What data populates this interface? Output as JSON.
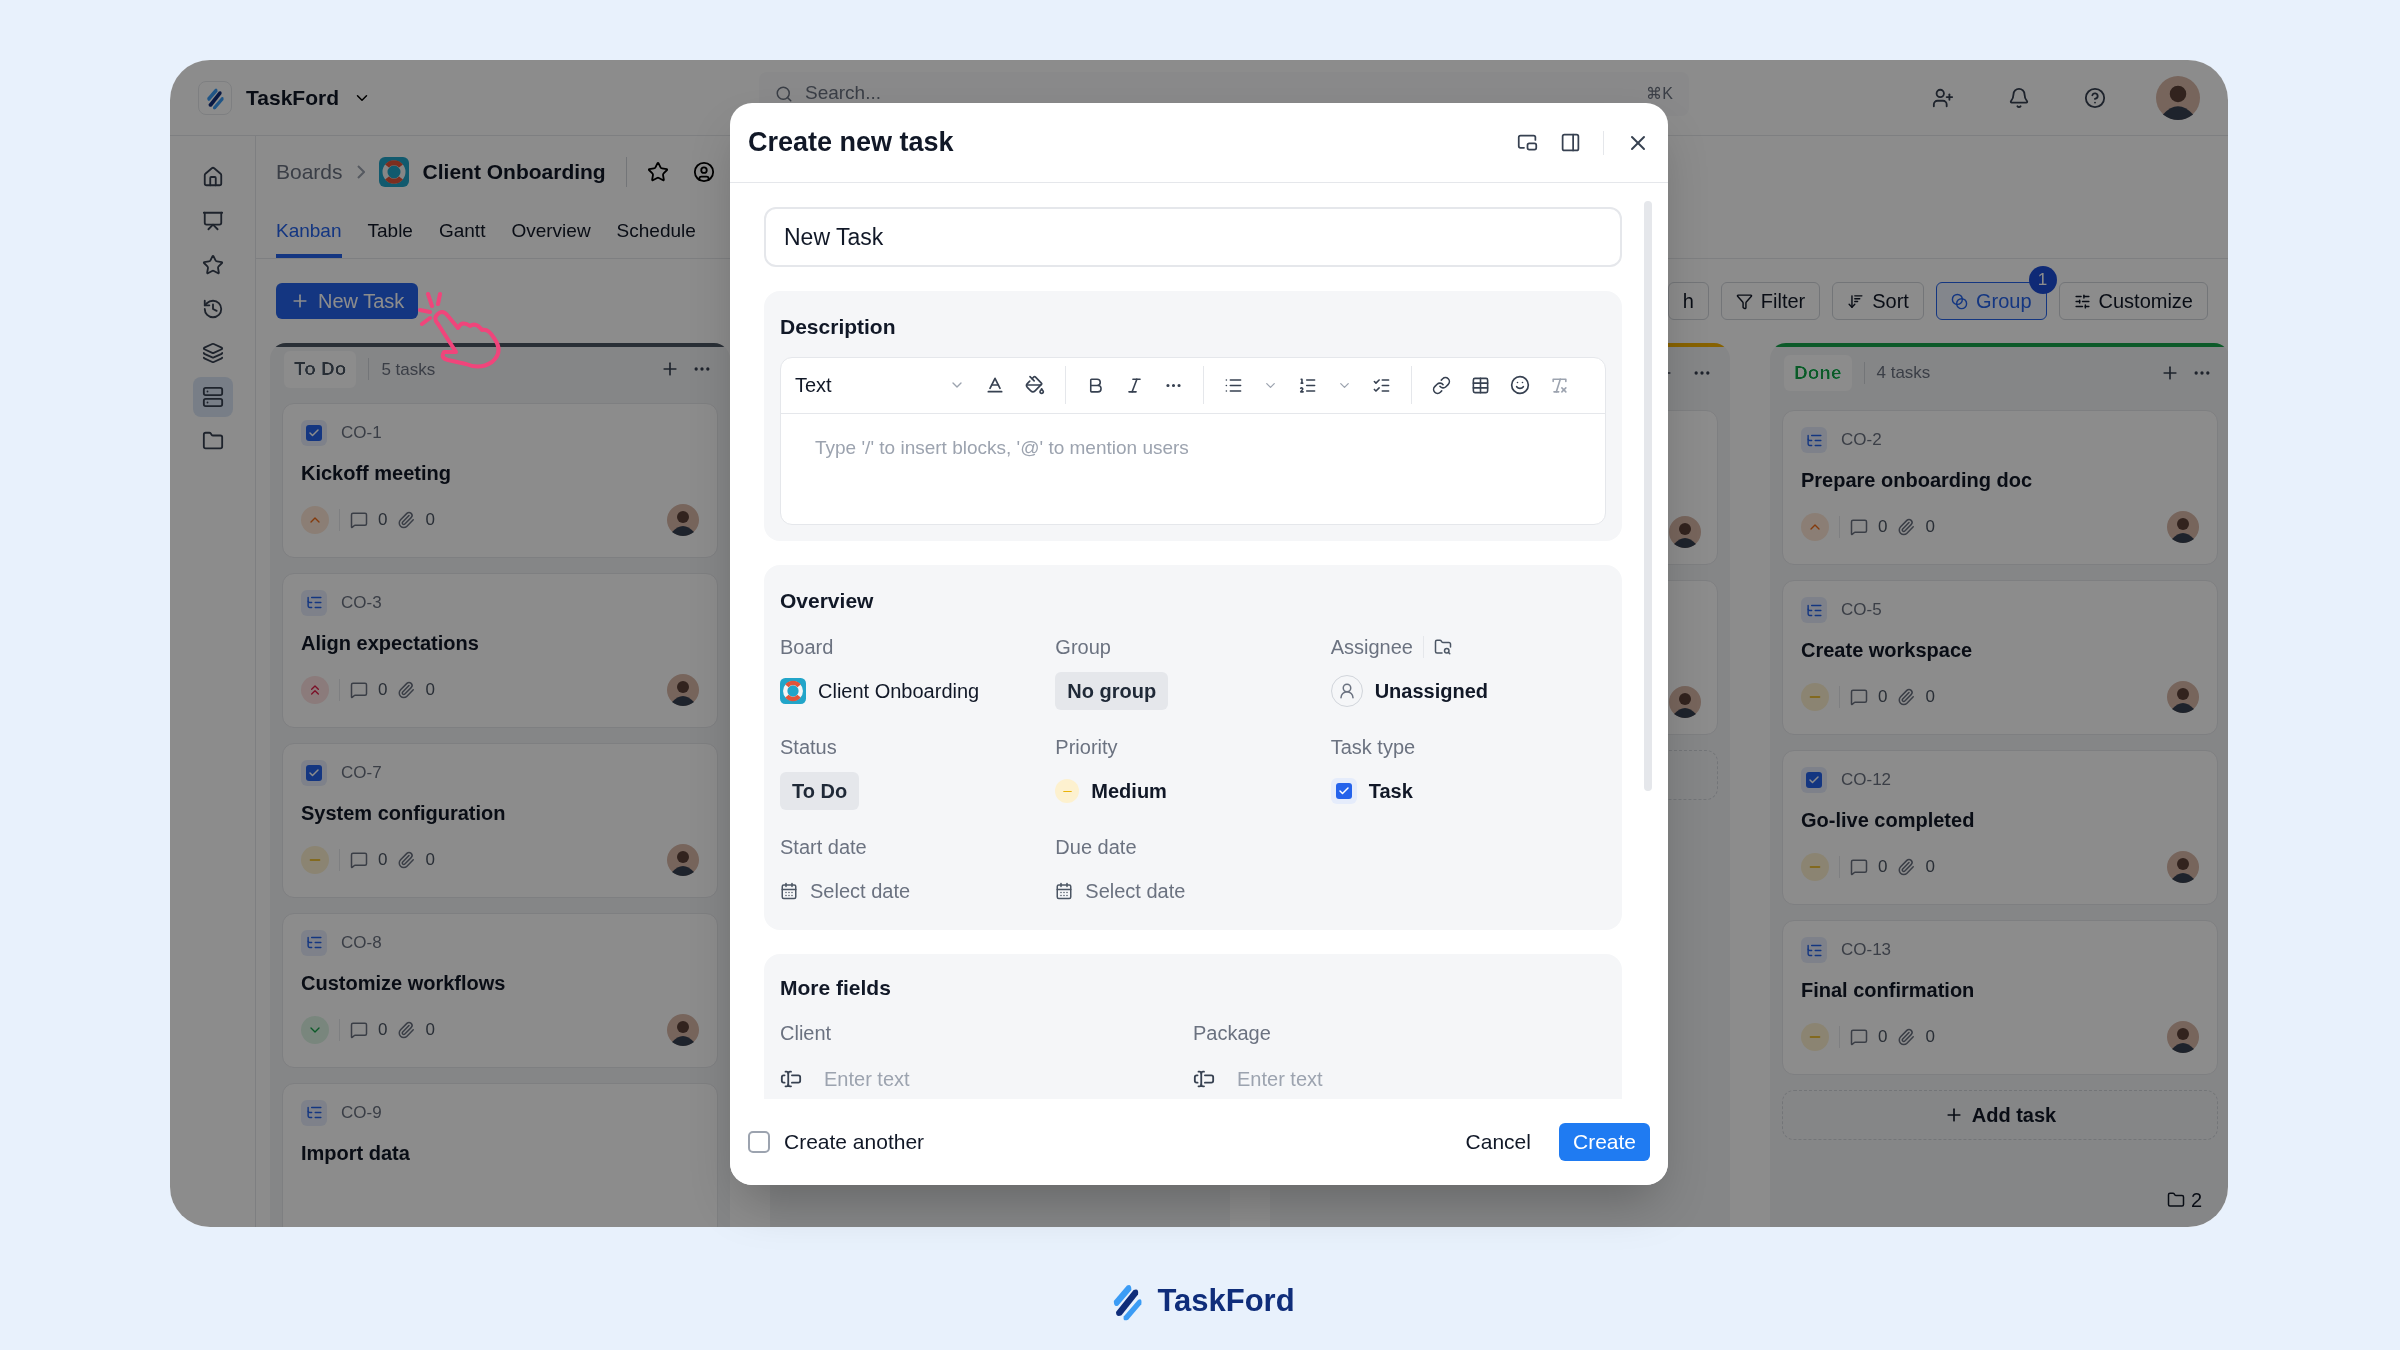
{
  "app": {
    "name": "TaskFord"
  },
  "search": {
    "placeholder": "Search...",
    "shortcut": "⌘K"
  },
  "breadcrumb": {
    "root": "Boards",
    "board": "Client Onboarding"
  },
  "tabs": [
    {
      "label": "Kanban",
      "selected": true
    },
    {
      "label": "Table",
      "selected": false
    },
    {
      "label": "Gantt",
      "selected": false
    },
    {
      "label": "Overview",
      "selected": false
    },
    {
      "label": "Schedule",
      "selected": false
    }
  ],
  "new_task_button": "New Task",
  "toolbar": [
    {
      "label": "h",
      "kind": "cut",
      "active": false
    },
    {
      "label": "Filter",
      "kind": "filter",
      "active": false
    },
    {
      "label": "Sort",
      "kind": "sort",
      "active": false
    },
    {
      "label": "Group",
      "kind": "group",
      "active": true,
      "badge": "1"
    },
    {
      "label": "Customize",
      "kind": "customize",
      "active": false
    }
  ],
  "columns": [
    {
      "kind": "open",
      "status": "To Do",
      "count": "5 tasks",
      "color": "#292f36",
      "cards": [
        {
          "id": "CO-1",
          "title": "Kickoff meeting",
          "kind": "task",
          "priority": {
            "kind": "high"
          },
          "comments": "0",
          "attachments": "0"
        },
        {
          "id": "CO-3",
          "title": "Align expectations",
          "kind": "subtask",
          "priority": {
            "kind": "urgent"
          },
          "comments": "0",
          "attachments": "0"
        },
        {
          "id": "CO-7",
          "title": "System configuration",
          "kind": "task",
          "priority": {
            "kind": "medium"
          },
          "comments": "0",
          "attachments": "0"
        },
        {
          "id": "CO-8",
          "title": "Customize workflows",
          "kind": "subtask",
          "priority": {
            "kind": "low"
          },
          "comments": "0",
          "attachments": "0"
        },
        {
          "id": "CO-9",
          "title": "Import data",
          "kind": "subtask"
        }
      ]
    },
    {
      "kind": "hidden"
    },
    {
      "kind": "covered",
      "color": "#876201"
    },
    {
      "kind": "open",
      "status": "Done",
      "count": "4 tasks",
      "color": "#0c5a29",
      "add_label": "Add task",
      "cards": [
        {
          "id": "CO-2",
          "title": "Prepare onboarding doc",
          "kind": "subtask",
          "priority": {
            "kind": "high"
          },
          "comments": "0",
          "attachments": "0"
        },
        {
          "id": "CO-5",
          "title": "Create workspace",
          "kind": "subtask",
          "priority": {
            "kind": "medium"
          },
          "comments": "0",
          "attachments": "0"
        },
        {
          "id": "CO-12",
          "title": "Go-live completed",
          "kind": "task",
          "priority": {
            "kind": "medium"
          },
          "comments": "0",
          "attachments": "0"
        },
        {
          "id": "CO-13",
          "title": "Final confirmation",
          "kind": "subtask",
          "priority": {
            "kind": "medium"
          },
          "comments": "0",
          "attachments": "0"
        }
      ]
    }
  ],
  "folder_count": "2",
  "dialog": {
    "title": "Create new task",
    "name_value": "New Task",
    "description": {
      "label": "Description",
      "format": "Text",
      "placeholder": "Type '/' to insert blocks, '@' to mention users"
    },
    "overview": {
      "label": "Overview",
      "fields": [
        {
          "label": "Board",
          "value": "Client Onboarding",
          "kind": "board"
        },
        {
          "label": "Group",
          "value": "No group",
          "kind": "tag"
        },
        {
          "label": "Assignee",
          "value": "Unassigned",
          "kind": "assignee"
        },
        {
          "label": "Status",
          "value": "To Do",
          "kind": "tag"
        },
        {
          "label": "Priority",
          "value": "Medium",
          "kind": "priority"
        },
        {
          "label": "Task type",
          "value": "Task",
          "kind": "task_type"
        },
        {
          "label": "Start date",
          "value": "Select date",
          "kind": "date"
        },
        {
          "label": "Due date",
          "value": "Select date",
          "kind": "date"
        }
      ]
    },
    "more_fields": {
      "label": "More fields",
      "fields": [
        {
          "label": "Client",
          "placeholder": "Enter text"
        },
        {
          "label": "Package",
          "placeholder": "Enter text"
        }
      ]
    },
    "create_another": {
      "label": "Create another",
      "checked": false
    },
    "buttons": [
      {
        "label": "Cancel",
        "kind": "secondary"
      },
      {
        "label": "Create",
        "kind": "primary"
      }
    ]
  },
  "brand": "TaskFord"
}
